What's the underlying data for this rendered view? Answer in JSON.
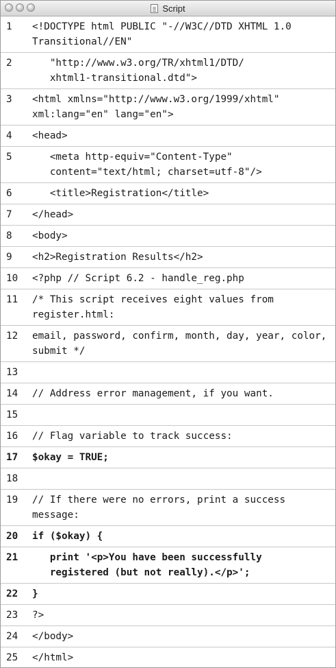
{
  "window": {
    "title": "Script"
  },
  "lines": [
    {
      "n": "1",
      "text": "<!DOCTYPE html PUBLIC \"-//W3C//DTD XHTML 1.0 Transitional//EN\"",
      "bold": false
    },
    {
      "n": "2",
      "text": "   \"http://www.w3.org/TR/xhtml1/DTD/\n   xhtml1-transitional.dtd\">",
      "bold": false
    },
    {
      "n": "3",
      "text": "<html xmlns=\"http://www.w3.org/1999/xhtml\" xml:lang=\"en\" lang=\"en\">",
      "bold": false
    },
    {
      "n": "4",
      "text": "<head>",
      "bold": false
    },
    {
      "n": "5",
      "text": "   <meta http-equiv=\"Content-Type\"\n   content=\"text/html; charset=utf-8\"/>",
      "bold": false
    },
    {
      "n": "6",
      "text": "   <title>Registration</title>",
      "bold": false
    },
    {
      "n": "7",
      "text": "</head>",
      "bold": false
    },
    {
      "n": "8",
      "text": "<body>",
      "bold": false
    },
    {
      "n": "9",
      "text": "<h2>Registration Results</h2>",
      "bold": false
    },
    {
      "n": "10",
      "text": "<?php // Script 6.2 - handle_reg.php",
      "bold": false
    },
    {
      "n": "11",
      "text": "/* This script receives eight values from register.html:",
      "bold": false
    },
    {
      "n": "12",
      "text": "email, password, confirm, month, day, year, color, submit */",
      "bold": false
    },
    {
      "n": "13",
      "text": "",
      "bold": false
    },
    {
      "n": "14",
      "text": "// Address error management, if you want.",
      "bold": false
    },
    {
      "n": "15",
      "text": "",
      "bold": false
    },
    {
      "n": "16",
      "text": "// Flag variable to track success:",
      "bold": false
    },
    {
      "n": "17",
      "text": "$okay = TRUE;",
      "bold": true
    },
    {
      "n": "18",
      "text": "",
      "bold": false
    },
    {
      "n": "19",
      "text": "// If there were no errors, print a success message:",
      "bold": false
    },
    {
      "n": "20",
      "text": "if ($okay) {",
      "bold": true
    },
    {
      "n": "21",
      "text": "   print '<p>You have been successfully\n   registered (but not really).</p>';",
      "bold": true
    },
    {
      "n": "22",
      "text": "}",
      "bold": true
    },
    {
      "n": "23",
      "text": "?>",
      "bold": false
    },
    {
      "n": "24",
      "text": "</body>",
      "bold": false
    },
    {
      "n": "25",
      "text": "</html>",
      "bold": false
    }
  ]
}
